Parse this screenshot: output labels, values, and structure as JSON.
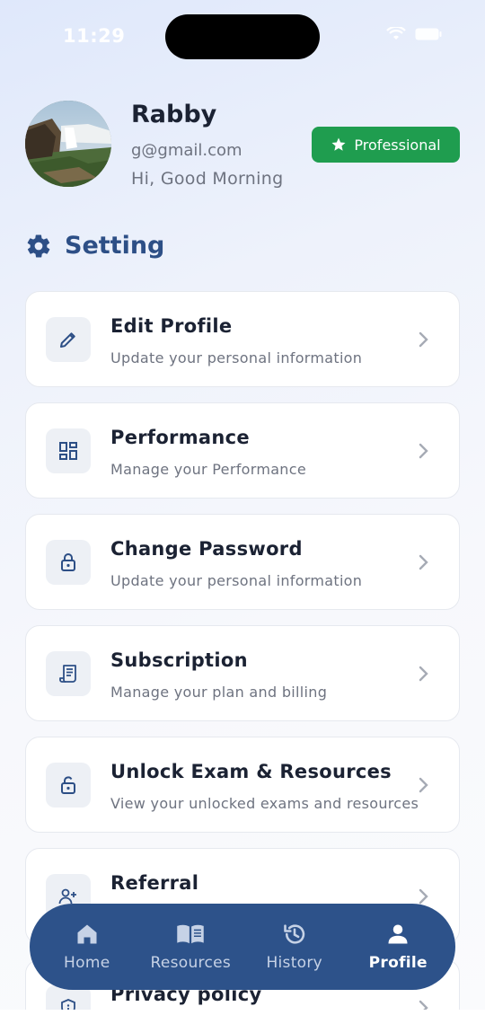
{
  "status_bar": {
    "time": "11:29"
  },
  "profile": {
    "name": "Rabby",
    "email": "g@gmail.com",
    "greeting": "Hi, Good Morning",
    "badge": "Professional"
  },
  "section": {
    "title": "Setting"
  },
  "menu": [
    {
      "title": "Edit Profile",
      "subtitle": "Update your personal information",
      "icon": "pencil-icon"
    },
    {
      "title": "Performance",
      "subtitle": "Manage your Performance",
      "icon": "dashboard-icon"
    },
    {
      "title": "Change Password",
      "subtitle": "Update your personal information",
      "icon": "lock-icon"
    },
    {
      "title": "Subscription",
      "subtitle": "Manage your plan and billing",
      "icon": "receipt-icon"
    },
    {
      "title": "Unlock Exam & Resources",
      "subtitle": "View your unlocked exams and resources",
      "icon": "unlock-icon"
    },
    {
      "title": "Referral",
      "subtitle": "",
      "icon": "add-user-icon"
    },
    {
      "title": "Privacy policy",
      "subtitle": "",
      "icon": "shield-icon"
    }
  ],
  "nav": [
    {
      "label": "Home",
      "icon": "home-icon",
      "active": false
    },
    {
      "label": "Resources",
      "icon": "book-icon",
      "active": false
    },
    {
      "label": "History",
      "icon": "history-icon",
      "active": false
    },
    {
      "label": "Profile",
      "icon": "person-icon",
      "active": true
    }
  ],
  "colors": {
    "accent": "#2d528a",
    "badge": "#1f9d4f",
    "title": "#2d4f86"
  }
}
